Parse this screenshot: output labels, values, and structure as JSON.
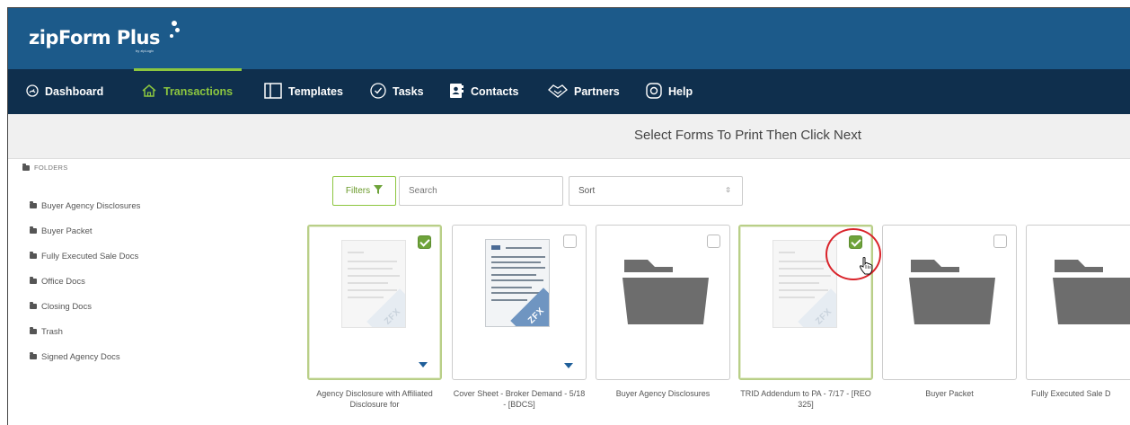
{
  "app": {
    "logo_text": "zipForm Plus",
    "logo_subtext": "by zipLogix"
  },
  "nav": {
    "items": [
      {
        "label": "Dashboard",
        "icon": "dashboard-icon"
      },
      {
        "label": "Transactions",
        "icon": "home-icon",
        "active": true
      },
      {
        "label": "Templates",
        "icon": "templates-icon"
      },
      {
        "label": "Tasks",
        "icon": "check-circle-icon"
      },
      {
        "label": "Contacts",
        "icon": "contacts-icon"
      },
      {
        "label": "Partners",
        "icon": "handshake-icon"
      },
      {
        "label": "Help",
        "icon": "help-icon"
      }
    ]
  },
  "page": {
    "title": "Select Forms To Print Then Click Next"
  },
  "sidebar": {
    "heading": "FOLDERS",
    "folders": [
      "Buyer Agency Disclosures",
      "Buyer Packet",
      "Fully Executed Sale Docs",
      "Office Docs",
      "Closing Docs",
      "Trash",
      "Signed Agency Docs"
    ]
  },
  "toolbar": {
    "filters_label": "Filters",
    "search_placeholder": "Search",
    "sort_label": "Sort"
  },
  "cards": [
    {
      "label": "Agency Disclosure with Affiliated Disclosure for",
      "type": "form",
      "selected": true,
      "checked": true
    },
    {
      "label": "Cover Sheet - Broker Demand - 5/18 - [BDCS]",
      "type": "form",
      "selected": false,
      "checked": false
    },
    {
      "label": "Buyer Agency Disclosures",
      "type": "folder",
      "selected": false,
      "checked": false
    },
    {
      "label": "TRID Addendum to PA - 7/17 - [REO 325]",
      "type": "form",
      "selected": true,
      "checked": true
    },
    {
      "label": "Buyer Packet",
      "type": "folder",
      "selected": false,
      "checked": false
    },
    {
      "label": "Fully Executed Sale D",
      "type": "folder",
      "selected": false,
      "checked": false
    }
  ],
  "form_badge": "ZFX",
  "colors": {
    "brand_bar": "#1c5a8a",
    "nav_bar": "#0f2f4d",
    "accent_green": "#8cc63f",
    "check_green": "#6ea33a",
    "highlight_red": "#d9232a",
    "folder_gray": "#6d6d6d"
  }
}
